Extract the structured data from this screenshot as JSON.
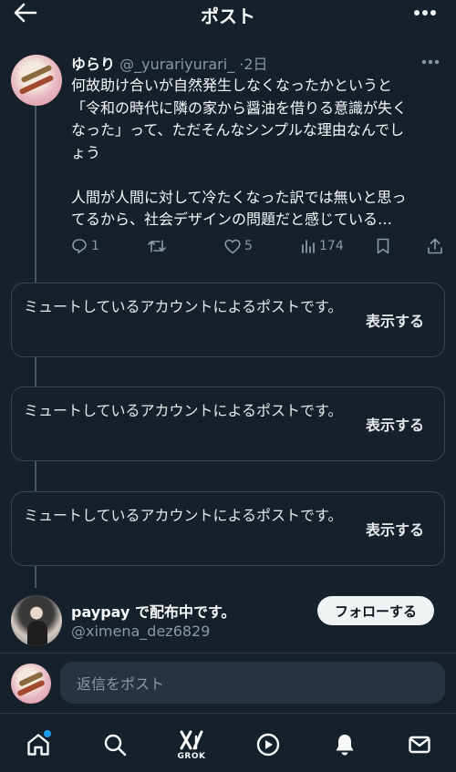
{
  "header": {
    "title": "ポスト",
    "back_icon": "arrow-left-icon",
    "more_icon": "ellipsis-icon"
  },
  "tweet": {
    "display_name": "ゆらり",
    "handle": "@_yurariyurari_",
    "separator": "·",
    "time": "2日",
    "lines": [
      "何故助け合いが自然発生しなくなったかというと",
      "「令和の時代に隣の家から醤油を借りる意識が失く",
      "なった」って、ただそんなシンプルな理由なんでし",
      "ょう",
      "",
      "人間が人間に対して冷たくなった訳では無いと思っ",
      "てるから、社会デザインの問題だと感じている…"
    ],
    "actions": {
      "reply_count": "1",
      "retweet_count": "",
      "like_count": "5",
      "views_count": "174"
    }
  },
  "muted_posts": [
    {
      "text": "ミュートしているアカウントによるポストです。",
      "show_label": "表示する"
    },
    {
      "text": "ミュートしているアカウントによるポストです。",
      "show_label": "表示する"
    },
    {
      "text": "ミュートしているアカウントによるポストです。",
      "show_label": "表示する"
    }
  ],
  "follow_user": {
    "name": "paypay で配布中です。",
    "handle": "@ximena_dez6829",
    "follow_label": "フォローする"
  },
  "reply": {
    "placeholder": "返信をポスト"
  },
  "nav": {
    "grok_label": "GROK",
    "items": [
      "home-icon",
      "search-icon",
      "grok-icon",
      "play-icon",
      "bell-icon",
      "mail-icon"
    ]
  },
  "colors": {
    "background": "#15202b",
    "text": "#f7f9f9",
    "secondary_text": "#8b98a5",
    "border": "#38444d",
    "accent": "#1d9bf0",
    "input_bg": "#273340"
  }
}
